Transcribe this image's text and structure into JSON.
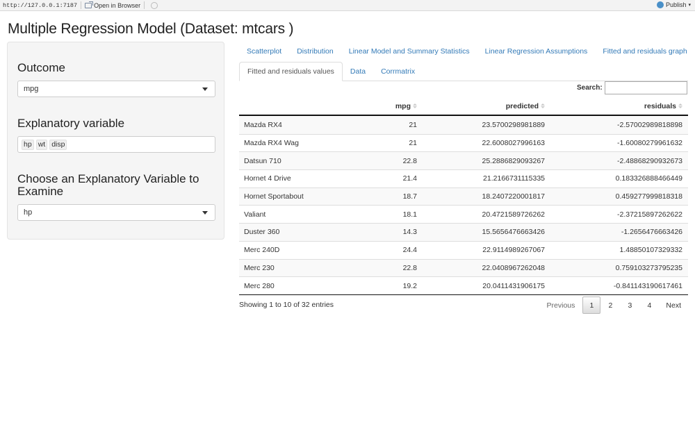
{
  "browser": {
    "url": "http://127.0.0.1:7187",
    "open_in_browser": "Open in Browser",
    "publish": "Publish"
  },
  "title": "Multiple Regression Model (Dataset: mtcars )",
  "sidebar": {
    "outcome_label": "Outcome",
    "outcome_value": "mpg",
    "explanatory_label": "Explanatory variable",
    "explanatory_values": [
      "hp",
      "wt",
      "disp"
    ],
    "examine_label": "Choose an Explanatory Variable to Examine",
    "examine_value": "hp"
  },
  "tabs_row1": [
    "Scatterplot",
    "Distribution",
    "Linear Model and Summary Statistics",
    "Linear Regression Assumptions",
    "Fitted and residuals graph"
  ],
  "tabs_row2": [
    "Fitted and residuals values",
    "Data",
    "Corrmatrix"
  ],
  "active_tab": "Fitted and residuals values",
  "search": {
    "label": "Search:",
    "value": ""
  },
  "table": {
    "columns": [
      "",
      "mpg",
      "predicted",
      "residuals"
    ],
    "rows": [
      [
        "Mazda RX4",
        "21",
        "23.5700298981889",
        "-2.57002989818898"
      ],
      [
        "Mazda RX4 Wag",
        "21",
        "22.6008027996163",
        "-1.60080279961632"
      ],
      [
        "Datsun 710",
        "22.8",
        "25.2886829093267",
        "-2.48868290932673"
      ],
      [
        "Hornet 4 Drive",
        "21.4",
        "21.2166731115335",
        "0.183326888466449"
      ],
      [
        "Hornet Sportabout",
        "18.7",
        "18.2407220001817",
        "0.459277999818318"
      ],
      [
        "Valiant",
        "18.1",
        "20.4721589726262",
        "-2.37215897262622"
      ],
      [
        "Duster 360",
        "14.3",
        "15.5656476663426",
        "-1.2656476663426"
      ],
      [
        "Merc 240D",
        "24.4",
        "22.9114989267067",
        "1.48850107329332"
      ],
      [
        "Merc 230",
        "22.8",
        "22.0408967262048",
        "0.759103273795235"
      ],
      [
        "Merc 280",
        "19.2",
        "20.0411431906175",
        "-0.841143190617461"
      ]
    ]
  },
  "info": "Showing 1 to 10 of 32 entries",
  "pagination": {
    "previous": "Previous",
    "pages": [
      "1",
      "2",
      "3",
      "4"
    ],
    "current": "1",
    "next": "Next"
  }
}
